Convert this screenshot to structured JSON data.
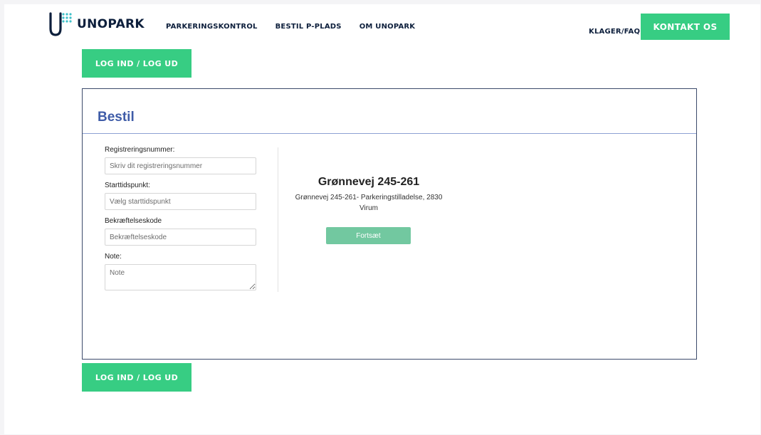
{
  "header": {
    "brand": "UNOPARK",
    "nav": [
      {
        "label": "PARKERINGSKONTROL"
      },
      {
        "label": "BESTIL P-PLADS"
      },
      {
        "label": "OM UNOPARK"
      }
    ],
    "faq_label": "KLAGER/FAQ",
    "contact_label": "KONTAKT OS"
  },
  "auth": {
    "login_label": "LOG IND / LOG UD"
  },
  "card": {
    "title": "Bestil",
    "form": {
      "registration": {
        "label": "Registreringsnummer:",
        "placeholder": "Skriv dit registreringsnummer",
        "value": ""
      },
      "start": {
        "label": "Starttidspunkt:",
        "placeholder": "Vælg starttidspunkt",
        "value": ""
      },
      "code": {
        "label": "Bekræftelseskode",
        "placeholder": "Bekræftelseskode",
        "value": ""
      },
      "note": {
        "label": "Note:",
        "placeholder": "Note",
        "value": ""
      }
    },
    "location": {
      "title": "Grønnevej 245-261",
      "description": "Grønnevej 245-261- Parkeringstilladelse, 2830 Virum"
    },
    "continue_label": "Fortsæt"
  },
  "colors": {
    "accent_green": "#37cd83",
    "continue_green": "#72c8a0",
    "title_blue": "#3f5ca8",
    "navy": "#0d1f3c",
    "logo_teal": "#3fc1c9"
  },
  "icons": {
    "logo": "unopark-logo-icon"
  }
}
